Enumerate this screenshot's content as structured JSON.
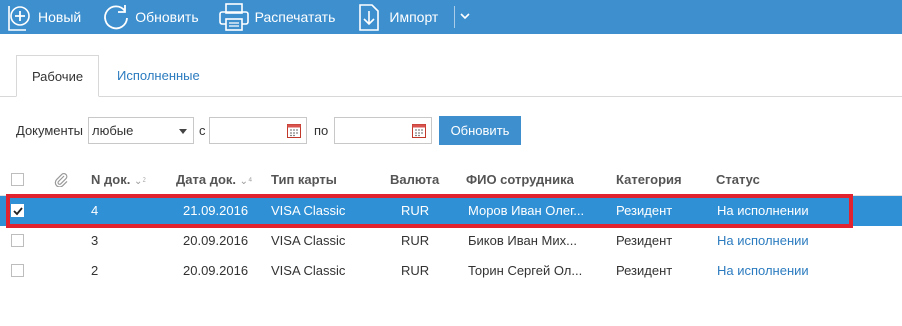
{
  "toolbar": {
    "new_label": "Новый",
    "refresh_label": "Обновить",
    "print_label": "Распечатать",
    "import_label": "Импорт",
    "more_icon": "chevron-down-icon"
  },
  "tabs": {
    "active": "Рабочие",
    "other": "Исполненные"
  },
  "filter": {
    "documents_label": "Документы",
    "documents_value": "любые",
    "from_label": "с",
    "to_label": "по",
    "from_value": "",
    "to_value": "",
    "refresh_button": "Обновить"
  },
  "table": {
    "headers": {
      "attachment_icon": "paperclip-icon",
      "doc_number": "N док.",
      "doc_date": "Дата док.",
      "card_type": "Тип карты",
      "currency": "Валюта",
      "employee": "ФИО сотрудника",
      "category": "Категория",
      "status": "Статус",
      "doc_number_sort": "⁲",
      "doc_date_sort": "⁴"
    },
    "rows": [
      {
        "number": "4",
        "date": "21.09.2016",
        "card": "VISA Classic",
        "currency": "RUR",
        "employee": "Моров Иван Олег...",
        "category": "Резидент",
        "status": "На исполнении",
        "selected": true
      },
      {
        "number": "3",
        "date": "20.09.2016",
        "card": "VISA Classic",
        "currency": "RUR",
        "employee": "Биков Иван Мих...",
        "category": "Резидент",
        "status": "На исполнении",
        "selected": false
      },
      {
        "number": "2",
        "date": "20.09.2016",
        "card": "VISA Classic",
        "currency": "RUR",
        "employee": "Торин Сергей Ол...",
        "category": "Резидент",
        "status": "На исполнении",
        "selected": false
      }
    ]
  },
  "colors": {
    "toolbar": "#3d8fce",
    "selected_row": "#2f90d5",
    "link": "#2c7cc0",
    "highlight_border": "#e0232e"
  }
}
